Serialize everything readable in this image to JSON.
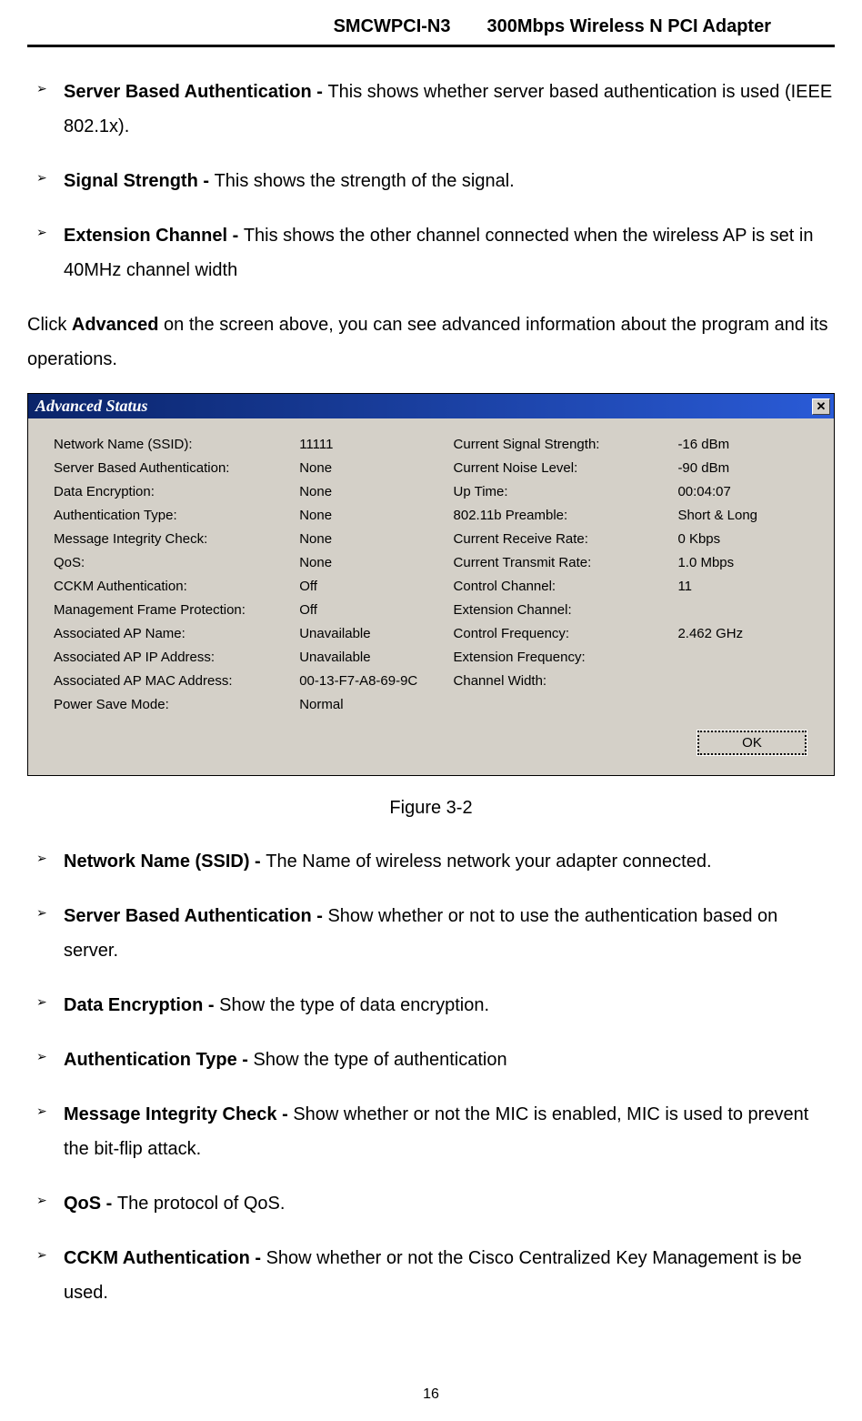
{
  "header": {
    "model": "SMCWPCI-N3",
    "product": "300Mbps Wireless N PCI Adapter"
  },
  "top_bullets": [
    {
      "term": "Server Based Authentication - ",
      "desc": "This shows whether server based authentication is used (IEEE 802.1x)."
    },
    {
      "term": "Signal Strength - ",
      "desc": "This shows the strength of the signal."
    },
    {
      "term": "Extension Channel - ",
      "desc": "This shows the other channel connected when the wireless AP is set in 40MHz channel width"
    }
  ],
  "para_click_prefix": "Click ",
  "para_click_bold": "Advanced",
  "para_click_suffix": " on the screen above, you can see advanced information about the program and its operations.",
  "dialog": {
    "title": "Advanced Status",
    "close_label": "✕",
    "ok_label": "OK",
    "left_rows": [
      {
        "label": "Network Name (SSID):",
        "value": "11111"
      },
      {
        "label": "Server Based Authentication:",
        "value": "None"
      },
      {
        "label": "Data Encryption:",
        "value": "None"
      },
      {
        "label": "Authentication Type:",
        "value": "None"
      },
      {
        "label": "Message Integrity Check:",
        "value": "None"
      },
      {
        "label": "QoS:",
        "value": "None"
      },
      {
        "label": "CCKM Authentication:",
        "value": "Off"
      },
      {
        "label": "Management Frame Protection:",
        "value": "Off"
      },
      {
        "label": "Associated AP Name:",
        "value": "Unavailable"
      },
      {
        "label": "Associated AP IP Address:",
        "value": "Unavailable"
      },
      {
        "label": "Associated AP MAC Address:",
        "value": "00-13-F7-A8-69-9C"
      },
      {
        "label": "Power Save Mode:",
        "value": "Normal"
      }
    ],
    "right_rows": [
      {
        "label": "Current Signal Strength:",
        "value": "-16 dBm"
      },
      {
        "label": "Current Noise Level:",
        "value": "-90 dBm"
      },
      {
        "label": "Up Time:",
        "value": "00:04:07"
      },
      {
        "label": "802.11b Preamble:",
        "value": "Short & Long"
      },
      {
        "label": "Current Receive Rate:",
        "value": "0 Kbps"
      },
      {
        "label": "Current Transmit Rate:",
        "value": "1.0 Mbps"
      },
      {
        "label": "Control Channel:",
        "value": "11"
      },
      {
        "label": "Extension Channel:",
        "value": ""
      },
      {
        "label": "Control Frequency:",
        "value": "2.462 GHz"
      },
      {
        "label": "Extension Frequency:",
        "value": ""
      },
      {
        "label": "Channel Width:",
        "value": ""
      }
    ]
  },
  "figure_caption": "Figure 3-2",
  "bottom_bullets": [
    {
      "term": "Network Name (SSID) - ",
      "desc": "The Name of wireless network your adapter connected."
    },
    {
      "term": "Server Based Authentication - ",
      "desc": "Show whether or not to use the authentication based on server."
    },
    {
      "term": "Data Encryption - ",
      "desc": "Show the type of data encryption."
    },
    {
      "term": "Authentication Type - ",
      "desc": "Show the type of authentication"
    },
    {
      "term": "Message Integrity Check - ",
      "desc": "Show whether or not the MIC is enabled, MIC is used to prevent the bit-flip attack."
    },
    {
      "term": "QoS - ",
      "desc": "The protocol of QoS."
    },
    {
      "term": "CCKM Authentication - ",
      "desc": "Show whether or not the Cisco Centralized Key Management is be used."
    }
  ],
  "page_number": "16"
}
